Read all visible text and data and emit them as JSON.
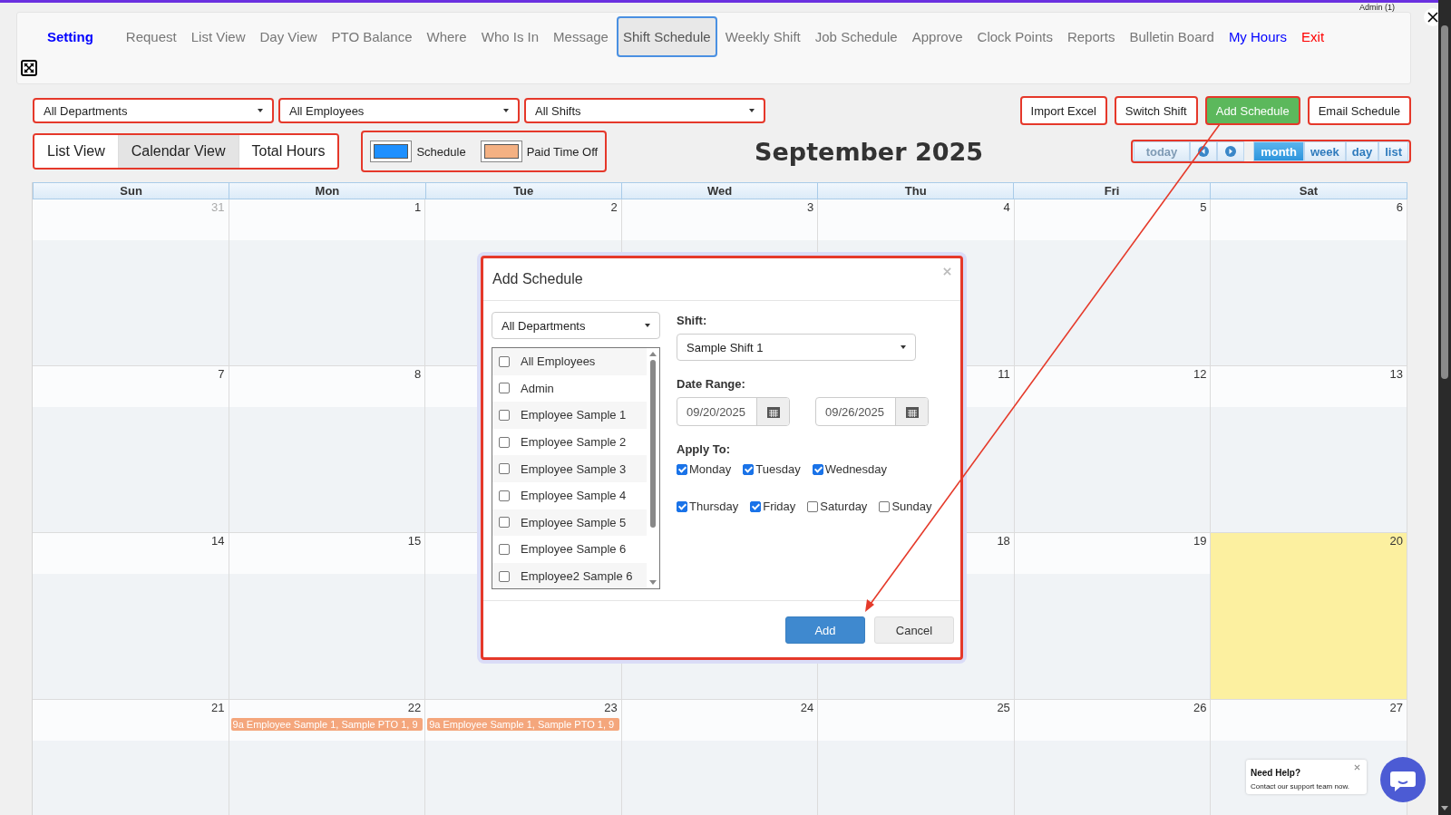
{
  "user": "Admin (1)",
  "nav": [
    {
      "label": "Setting",
      "kind": "title",
      "selected": false,
      "color": "#0000ff"
    },
    {
      "label": "Request",
      "kind": "link",
      "selected": false,
      "color": "#777777"
    },
    {
      "label": "List View",
      "kind": "link",
      "selected": false,
      "color": "#777777"
    },
    {
      "label": "Day View",
      "kind": "link",
      "selected": false,
      "color": "#777777"
    },
    {
      "label": "PTO Balance",
      "kind": "link",
      "selected": false,
      "color": "#777777"
    },
    {
      "label": "Where",
      "kind": "link",
      "selected": false,
      "color": "#777777"
    },
    {
      "label": "Who Is In",
      "kind": "link",
      "selected": false,
      "color": "#777777"
    },
    {
      "label": "Message",
      "kind": "link",
      "selected": false,
      "color": "#777777"
    },
    {
      "label": "Shift Schedule",
      "kind": "link",
      "selected": true,
      "color": "#555555"
    },
    {
      "label": "Weekly Shift",
      "kind": "link",
      "selected": false,
      "color": "#777777"
    },
    {
      "label": "Job Schedule",
      "kind": "link",
      "selected": false,
      "color": "#777777"
    },
    {
      "label": "Approve",
      "kind": "link",
      "selected": false,
      "color": "#777777"
    },
    {
      "label": "Clock Points",
      "kind": "link",
      "selected": false,
      "color": "#777777"
    },
    {
      "label": "Reports",
      "kind": "link",
      "selected": false,
      "color": "#777777"
    },
    {
      "label": "Bulletin Board",
      "kind": "link",
      "selected": false,
      "color": "#777777"
    },
    {
      "label": "My Hours",
      "kind": "link",
      "selected": false,
      "color": "#0000ff"
    },
    {
      "label": "Exit",
      "kind": "link",
      "selected": false,
      "color": "#ff0000"
    }
  ],
  "filters": [
    {
      "value": "All Departments"
    },
    {
      "value": "All Employees"
    },
    {
      "value": "All Shifts"
    }
  ],
  "actions": [
    {
      "label": "Import Excel",
      "kind": "plain"
    },
    {
      "label": "Switch Shift",
      "kind": "plain"
    },
    {
      "label": "Add Schedule",
      "kind": "primary"
    },
    {
      "label": "Email Schedule",
      "kind": "plain"
    }
  ],
  "view_tabs": [
    {
      "label": "List View",
      "selected": false
    },
    {
      "label": "Calendar View",
      "selected": true
    },
    {
      "label": "Total Hours",
      "selected": false
    }
  ],
  "legend": [
    {
      "label": "Schedule",
      "color": "#1e90ff"
    },
    {
      "label": "Paid Time Off",
      "color": "#f4b183"
    }
  ],
  "calendar": {
    "title": "September 2025",
    "today_button": {
      "label": "today",
      "disabled": true
    },
    "views": [
      {
        "label": "month",
        "selected": true
      },
      {
        "label": "week",
        "selected": false
      },
      {
        "label": "day",
        "selected": false
      },
      {
        "label": "list",
        "selected": false
      }
    ],
    "weekdays": [
      "Sun",
      "Mon",
      "Tue",
      "Wed",
      "Thu",
      "Fri",
      "Sat"
    ],
    "weeks": [
      {
        "sun": {
          "date": "31",
          "other_month": true,
          "today": false
        },
        "mon": {
          "date": "1",
          "other_month": false,
          "today": false
        },
        "tue": {
          "date": "2",
          "other_month": false,
          "today": false
        },
        "wed": {
          "date": "3",
          "other_month": false,
          "today": false
        },
        "thu": {
          "date": "4",
          "other_month": false,
          "today": false
        },
        "fri": {
          "date": "5",
          "other_month": false,
          "today": false
        },
        "sat": {
          "date": "6",
          "other_month": false,
          "today": false
        }
      },
      {
        "sun": {
          "date": "7",
          "other_month": false,
          "today": false
        },
        "mon": {
          "date": "8",
          "other_month": false,
          "today": false
        },
        "thu": {
          "date": "11",
          "other_month": false,
          "today": false
        },
        "fri": {
          "date": "12",
          "other_month": false,
          "today": false
        },
        "sat": {
          "date": "13",
          "other_month": false,
          "today": false
        }
      },
      {
        "sun": {
          "date": "14",
          "other_month": false,
          "today": false
        },
        "mon": {
          "date": "15",
          "other_month": false,
          "today": false
        },
        "thu": {
          "date": "18",
          "other_month": false,
          "today": false
        },
        "fri": {
          "date": "19",
          "other_month": false,
          "today": false
        },
        "sat": {
          "date": "20",
          "other_month": false,
          "today": true
        }
      },
      {
        "sun": {
          "date": "21",
          "other_month": false,
          "today": false
        },
        "mon": {
          "date": "22",
          "other_month": false,
          "today": false,
          "events": [
            {
              "text": "9a Employee Sample 1, Sample PTO 1, 9",
              "color": "#f4a67c"
            }
          ]
        },
        "tue": {
          "date": "23",
          "other_month": false,
          "today": false,
          "events": [
            {
              "text": "9a Employee Sample 1, Sample PTO 1, 9",
              "color": "#f4a67c"
            }
          ]
        },
        "wed": {
          "date": "24",
          "other_month": false,
          "today": false
        },
        "thu": {
          "date": "25",
          "other_month": false,
          "today": false
        },
        "fri": {
          "date": "26",
          "other_month": false,
          "today": false
        },
        "sat": {
          "date": "27",
          "other_month": false,
          "today": false
        }
      }
    ]
  },
  "dialog": {
    "title": "Add Schedule",
    "department": {
      "value": "All Departments"
    },
    "employees": [
      {
        "name": "All Employees",
        "checked": false
      },
      {
        "name": "Admin",
        "checked": false
      },
      {
        "name": "Employee Sample 1",
        "checked": false
      },
      {
        "name": "Employee Sample 2",
        "checked": false
      },
      {
        "name": "Employee Sample 3",
        "checked": false
      },
      {
        "name": "Employee Sample 4",
        "checked": false
      },
      {
        "name": "Employee Sample 5",
        "checked": false
      },
      {
        "name": "Employee Sample 6",
        "checked": false
      },
      {
        "name": "Employee2 Sample 6",
        "checked": false
      }
    ],
    "shift_label": "Shift:",
    "shift": {
      "value": "Sample Shift 1"
    },
    "date_range_label": "Date Range:",
    "date_from": {
      "value": "09/20/2025"
    },
    "date_to": {
      "value": "09/26/2025"
    },
    "apply_label": "Apply To:",
    "days": [
      {
        "label": "Monday",
        "checked": true
      },
      {
        "label": "Tuesday",
        "checked": true
      },
      {
        "label": "Wednesday",
        "checked": true
      },
      {
        "label": "Thursday",
        "checked": true
      },
      {
        "label": "Friday",
        "checked": true
      },
      {
        "label": "Saturday",
        "checked": false
      },
      {
        "label": "Sunday",
        "checked": false
      }
    ],
    "buttons": [
      {
        "label": "Add",
        "kind": "primary"
      },
      {
        "label": "Cancel",
        "kind": "plain"
      }
    ]
  },
  "help": {
    "title": "Need Help?",
    "text": "Contact our support team now."
  }
}
